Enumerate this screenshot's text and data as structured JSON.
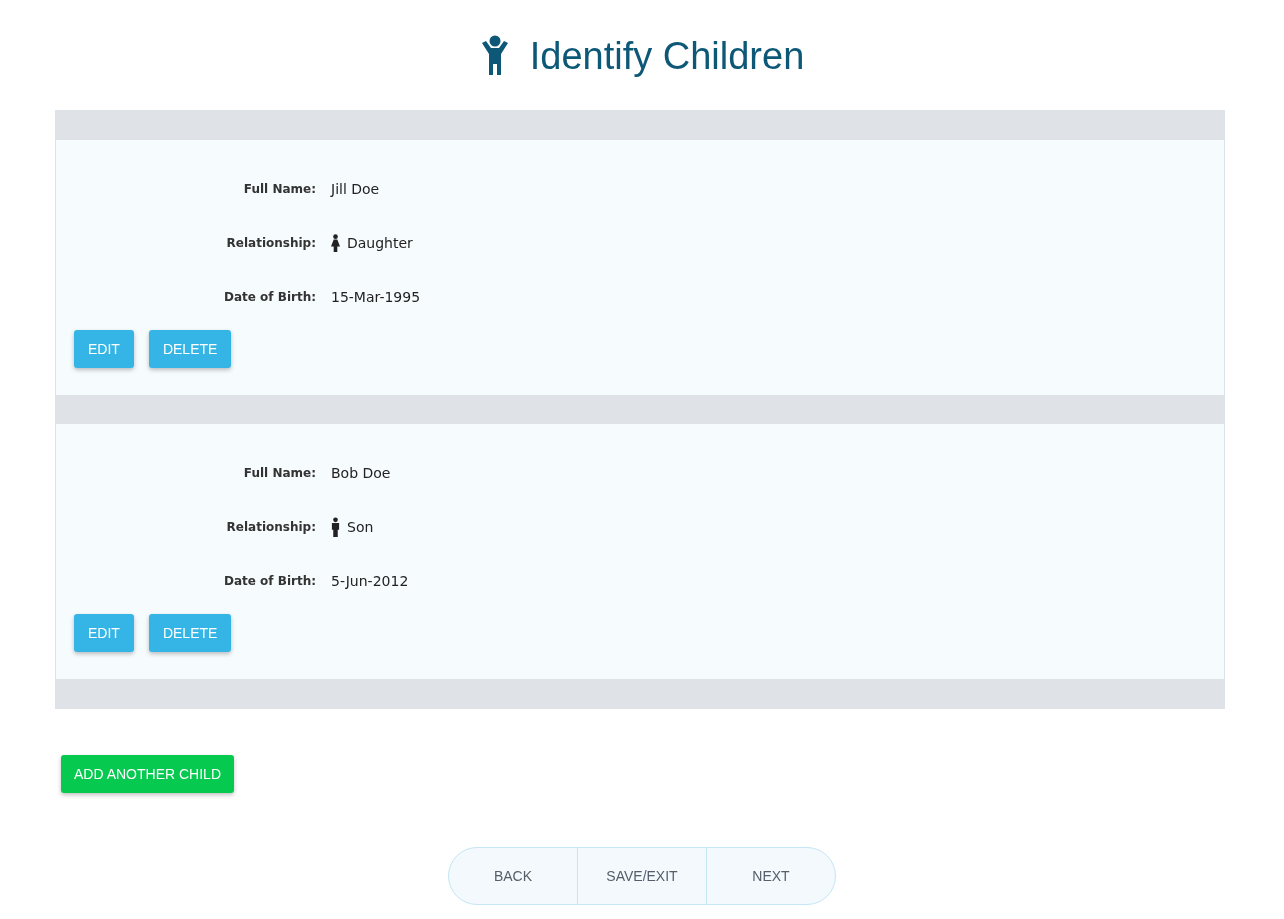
{
  "title": "Identify Children",
  "children": [
    {
      "fields": [
        {
          "label": "Full Name:",
          "value": "Jill Doe"
        },
        {
          "label": "Relationship:",
          "value": "Daughter",
          "kind": "female"
        },
        {
          "label": "Date of Birth:",
          "value": "15-Mar-1995"
        }
      ],
      "buttons": [
        "EDIT",
        "DELETE"
      ]
    },
    {
      "fields": [
        {
          "label": "Full Name:",
          "value": "Bob Doe"
        },
        {
          "label": "Relationship:",
          "value": "Son",
          "kind": "male"
        },
        {
          "label": "Date of Birth:",
          "value": "5-Jun-2012"
        }
      ],
      "buttons": [
        "EDIT",
        "DELETE"
      ]
    }
  ],
  "add_button": "ADD ANOTHER CHILD",
  "nav": [
    "BACK",
    "SAVE/EXIT",
    "NEXT"
  ]
}
